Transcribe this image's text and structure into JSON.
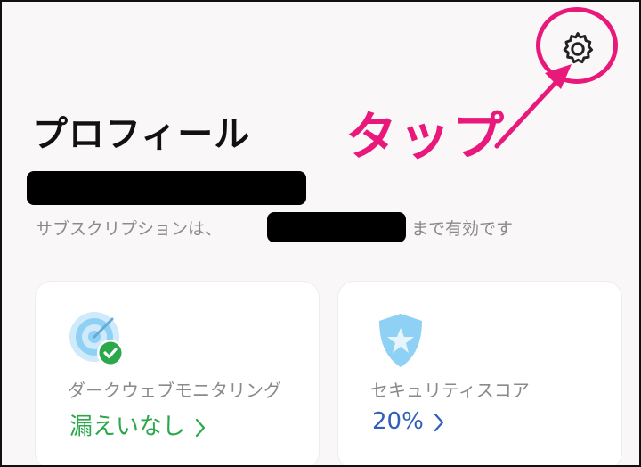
{
  "header": {
    "title": "プロフィール",
    "annotation": "タップ"
  },
  "subscription": {
    "prefix": "サブスクリプションは、",
    "suffix": "まで有効です"
  },
  "cards": [
    {
      "title": "ダークウェブモニタリング",
      "value": "漏えいなし",
      "icon": "target-check-icon"
    },
    {
      "title": "セキュリティスコア",
      "value": "20%",
      "icon": "shield-star-icon"
    }
  ],
  "colors": {
    "annotation": "#e8197a",
    "ok_green": "#2aa84a",
    "score_blue": "#2f5fb8",
    "icon_light_blue": "#8fd0f5"
  }
}
